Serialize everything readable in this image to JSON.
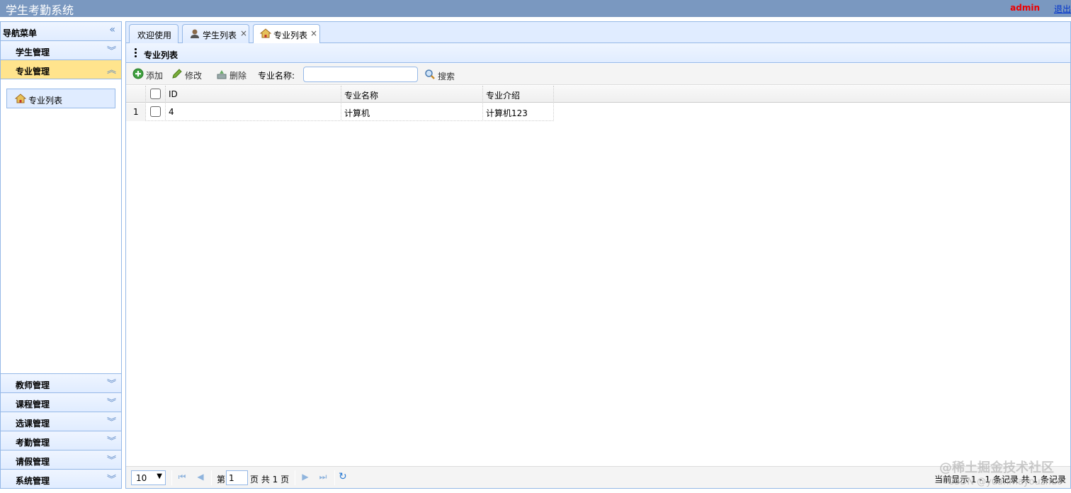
{
  "header": {
    "app_title": "学生考勤系统",
    "user": "admin",
    "logout": "退出"
  },
  "sidebar": {
    "title": "导航菜单",
    "groups_top": [
      {
        "label": "学生管理",
        "expanded": false
      },
      {
        "label": "专业管理",
        "expanded": true
      }
    ],
    "active_subitem": "专业列表",
    "groups_bottom": [
      {
        "label": "教师管理"
      },
      {
        "label": "课程管理"
      },
      {
        "label": "选课管理"
      },
      {
        "label": "考勤管理"
      },
      {
        "label": "请假管理"
      },
      {
        "label": "系统管理"
      }
    ]
  },
  "tabs": [
    {
      "label": "欢迎使用",
      "closable": false,
      "selected": false
    },
    {
      "label": "学生列表",
      "closable": true,
      "selected": false,
      "icon": "user-icon"
    },
    {
      "label": "专业列表",
      "closable": true,
      "selected": true,
      "icon": "home-icon"
    }
  ],
  "tab_close_glyph": "×",
  "panel": {
    "title": "专业列表"
  },
  "toolbar": {
    "add_label": "添加",
    "edit_label": "修改",
    "delete_label": "删除",
    "search_field_label": "专业名称:",
    "search_value": "",
    "search_label": "搜索"
  },
  "grid": {
    "columns": [
      "ID",
      "专业名称",
      "专业介绍"
    ],
    "rows": [
      {
        "row_number": "1",
        "id": "4",
        "name": "计算机",
        "intro": "计算机123"
      }
    ]
  },
  "pager": {
    "page_size": "10",
    "page_prefix": "第",
    "page_value": "1",
    "page_suffix": "页 共 1 页",
    "info": "当前显示 1 - 1 条记录 共 1 条记录"
  },
  "watermark": {
    "line1": "@稀土掘金技术社区",
    "line2": "CSDN @yuanmayouzhuo"
  },
  "colors": {
    "header_bg": "#7a98c0",
    "panel_border": "#95b8e7",
    "accent_active": "#ffe48d",
    "user_name": "#ee0000"
  }
}
